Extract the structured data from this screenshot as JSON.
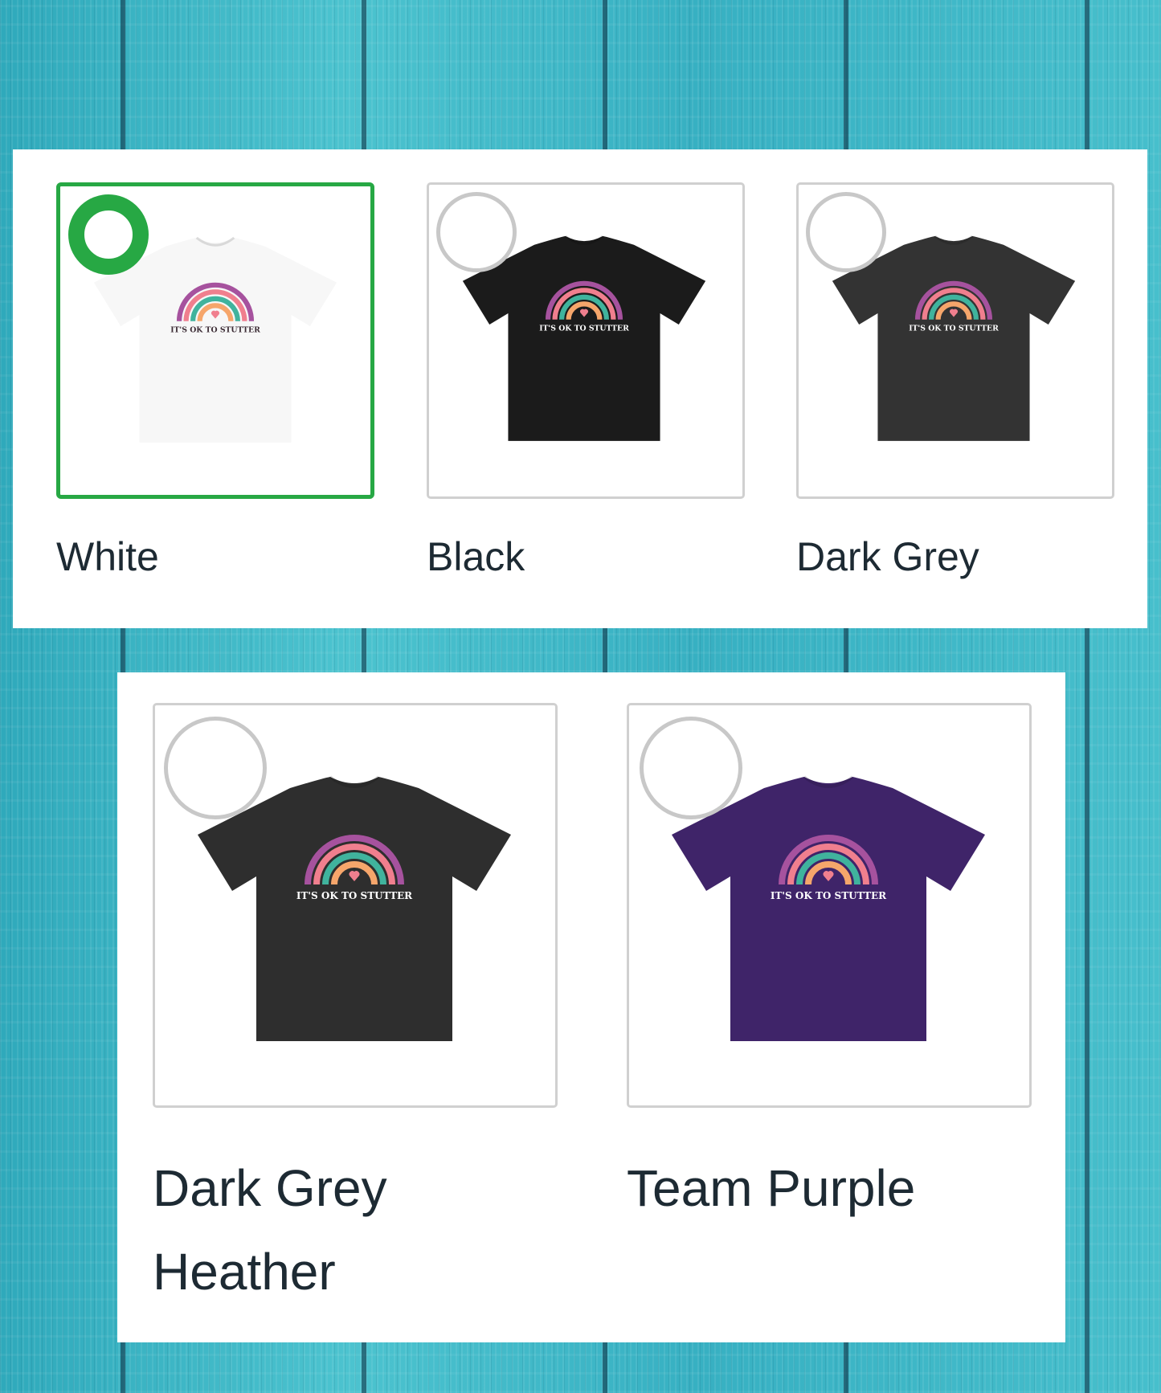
{
  "variants": [
    {
      "label": "White",
      "shirt_color": "#f7f7f7",
      "selected": true,
      "print_text": "IT'S OK TO STUTTER",
      "text_color": "#3a2a33"
    },
    {
      "label": "Black",
      "shirt_color": "#1b1b1b",
      "selected": false,
      "print_text": "IT'S OK TO STUTTER",
      "text_color": "#ffffff"
    },
    {
      "label": "Dark Grey",
      "shirt_color": "#333333",
      "selected": false,
      "print_text": "IT'S OK TO STUTTER",
      "text_color": "#ffffff"
    },
    {
      "label": "Dark Grey Heather",
      "shirt_color": "#2e2e2e",
      "selected": false,
      "print_text": "IT'S OK TO STUTTER",
      "text_color": "#ffffff"
    },
    {
      "label": "Team Purple",
      "shirt_color": "#3f2469",
      "selected": false,
      "print_text": "IT'S OK TO STUTTER",
      "text_color": "#ffffff"
    }
  ],
  "colors": {
    "selected_accent": "#27a844",
    "rainbow": [
      "#a6529e",
      "#f07f8e",
      "#40b39d",
      "#f6a66b",
      "#f07f8e"
    ]
  },
  "icons": {
    "radio": "radio-circle-icon",
    "heart": "heart-icon"
  }
}
